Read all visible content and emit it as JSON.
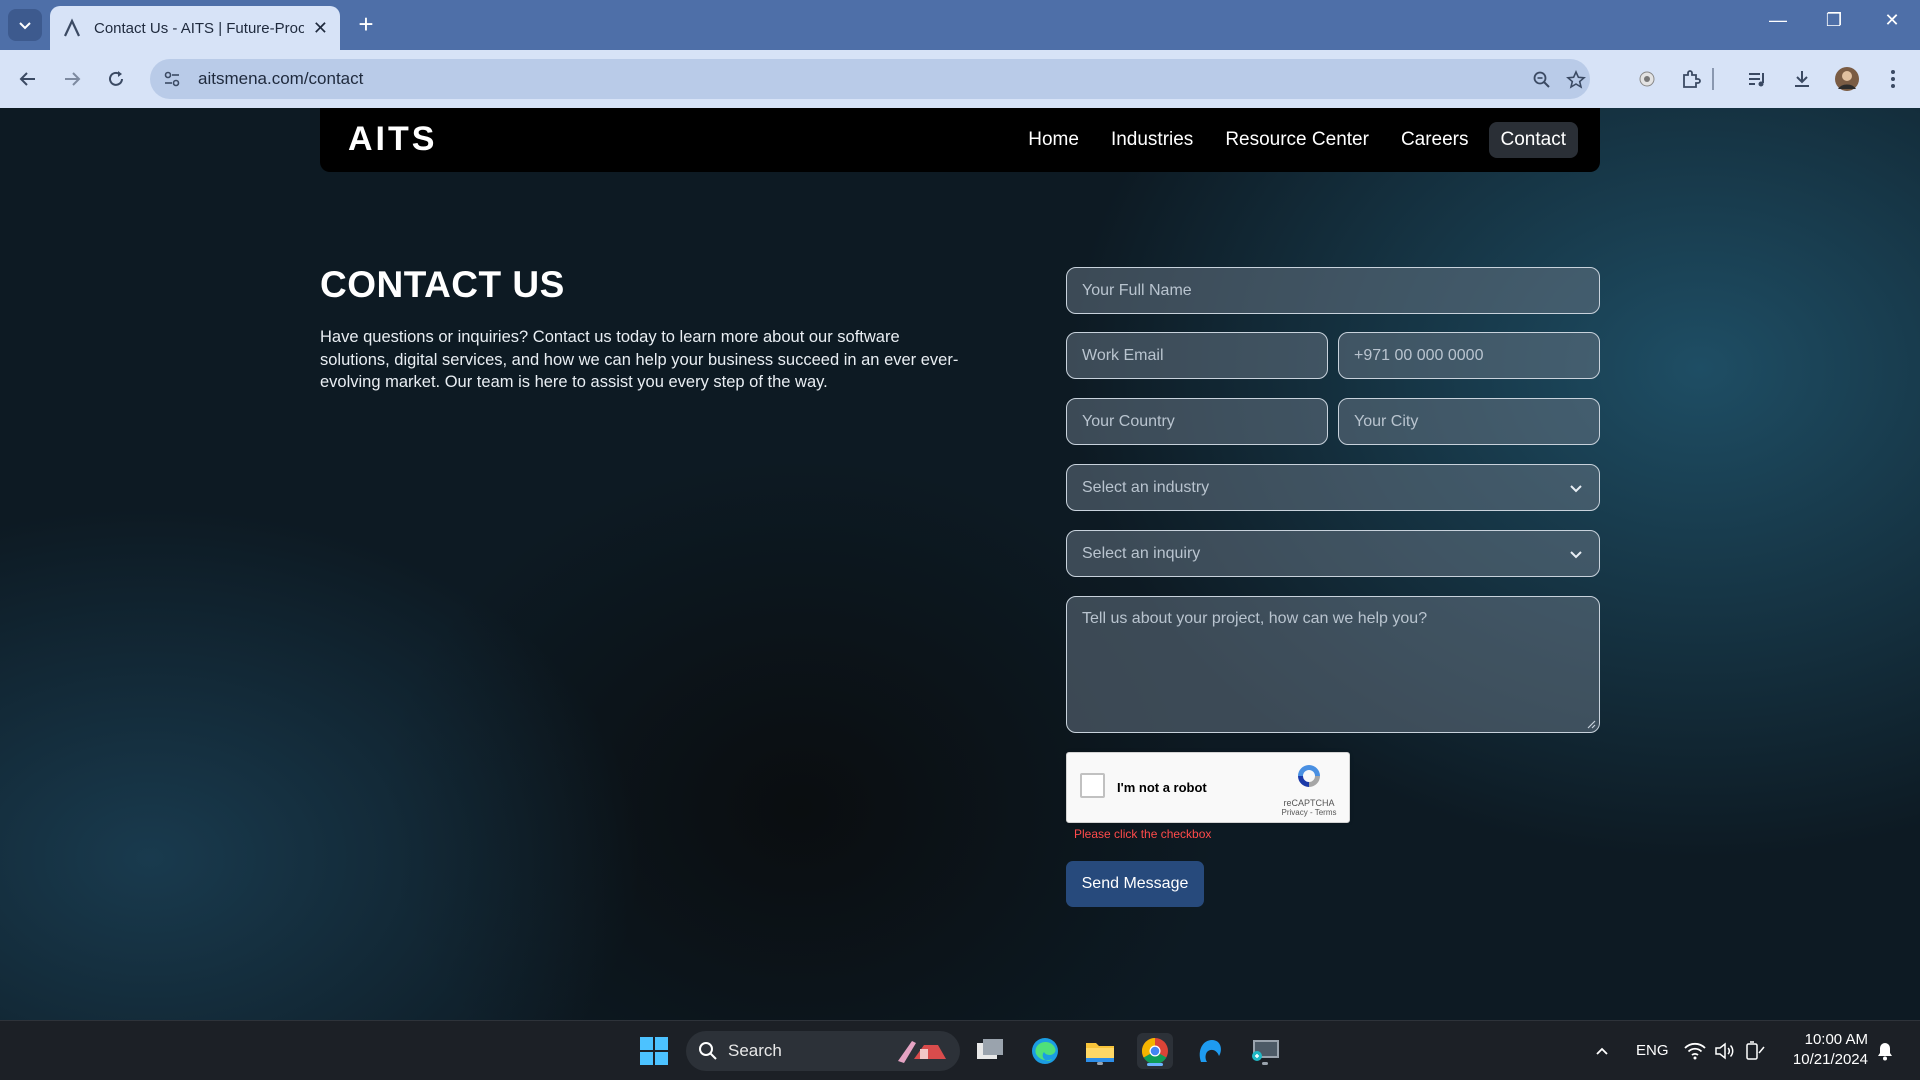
{
  "browser": {
    "tab": {
      "title": "Contact Us - AITS | Future-Proo",
      "favicon": "aits-logo-icon"
    },
    "url": "aitsmena.com/contact"
  },
  "site": {
    "logo_text": "AITS",
    "nav": [
      {
        "label": "Home",
        "active": false
      },
      {
        "label": "Industries",
        "active": false
      },
      {
        "label": "Resource Center",
        "active": false
      },
      {
        "label": "Careers",
        "active": false
      },
      {
        "label": "Contact",
        "active": true
      }
    ]
  },
  "contact": {
    "title": "CONTACT US",
    "description": "Have questions or inquiries? Contact us today to learn more about our software solutions, digital services, and how we can help your business succeed in an ever ever-evolving market. Our team is here to assist you every step of the way."
  },
  "form": {
    "full_name": {
      "placeholder": "Your Full Name",
      "value": ""
    },
    "work_email": {
      "placeholder": "Work Email",
      "value": ""
    },
    "phone": {
      "placeholder": "+971 00 000 0000",
      "value": ""
    },
    "country": {
      "placeholder": "Your Country",
      "value": ""
    },
    "city": {
      "placeholder": "Your City",
      "value": ""
    },
    "industry": {
      "selected": "Select an industry"
    },
    "inquiry": {
      "selected": "Select an inquiry"
    },
    "message": {
      "placeholder": "Tell us about your project, how can we help you?",
      "value": ""
    },
    "recaptcha": {
      "label": "I'm not a robot",
      "brand": "reCAPTCHA",
      "links": "Privacy - Terms",
      "error": "Please click the checkbox"
    },
    "submit_label": "Send Message"
  },
  "taskbar": {
    "search_label": "Search",
    "language": "ENG",
    "time": "10:00 AM",
    "date": "10/21/2024"
  },
  "colors": {
    "accent_button": "#274a7c",
    "error": "#ff4b4b",
    "chrome_tabbar": "#4e6fa8",
    "chrome_toolbar": "#d7e3f7"
  }
}
